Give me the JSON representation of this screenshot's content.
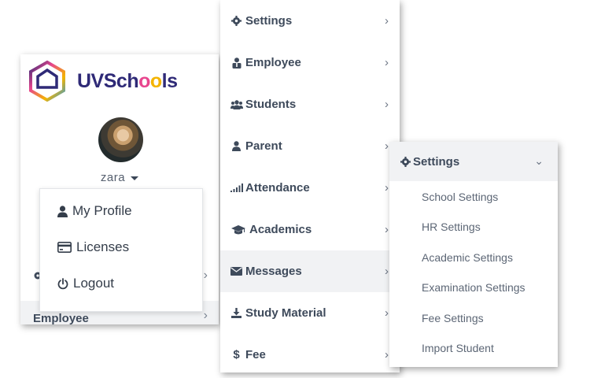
{
  "left_panel": {
    "brand": {
      "uv": "UV",
      "sch": "Sch",
      "o1": "o",
      "o2": "o",
      "ls": "ls"
    },
    "user": {
      "name": "zara"
    },
    "behind_rows": {
      "employee_label": "Employee"
    },
    "user_menu": [
      {
        "label": "My Profile",
        "icon": "user-icon"
      },
      {
        "label": "Licenses",
        "icon": "credit-card-icon"
      },
      {
        "label": "Logout",
        "icon": "power-icon"
      }
    ]
  },
  "main_menu": {
    "items": [
      {
        "label": "Settings",
        "icon": "gear-icon"
      },
      {
        "label": "Employee",
        "icon": "employee-icon"
      },
      {
        "label": "Students",
        "icon": "users-icon"
      },
      {
        "label": "Parent",
        "icon": "user-icon"
      },
      {
        "label": "Attendance",
        "icon": "signal-icon"
      },
      {
        "label": "Academics",
        "icon": "graduation-cap-icon"
      },
      {
        "label": "Messages",
        "icon": "envelope-icon",
        "active": true
      },
      {
        "label": "Study Material",
        "icon": "download-icon"
      },
      {
        "label": "Fee",
        "icon": "dollar-icon"
      }
    ]
  },
  "settings_submenu": {
    "header": "Settings",
    "items": [
      "School Settings",
      "HR Settings",
      "Academic Settings",
      "Examination Settings",
      "Fee Settings",
      "Import Student"
    ]
  },
  "colors": {
    "brand_navy": "#2f2a77",
    "brand_pink": "#e8468e",
    "brand_yellow": "#f4b400",
    "menu_text": "#3e4a5b",
    "active_row": "#f1f2f4"
  }
}
